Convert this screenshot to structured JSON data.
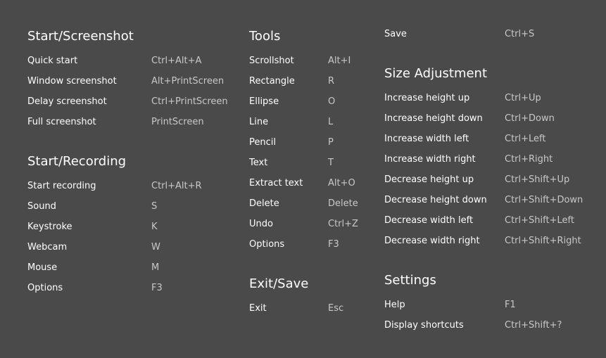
{
  "sections": {
    "start_screenshot": {
      "title": "Start/Screenshot",
      "items": [
        {
          "label": "Quick start",
          "key": "Ctrl+Alt+A"
        },
        {
          "label": "Window screenshot",
          "key": "Alt+PrintScreen"
        },
        {
          "label": "Delay screenshot",
          "key": "Ctrl+PrintScreen"
        },
        {
          "label": "Full screenshot",
          "key": "PrintScreen"
        }
      ]
    },
    "start_recording": {
      "title": "Start/Recording",
      "items": [
        {
          "label": "Start recording",
          "key": "Ctrl+Alt+R"
        },
        {
          "label": "Sound",
          "key": "S"
        },
        {
          "label": "Keystroke",
          "key": "K"
        },
        {
          "label": "Webcam",
          "key": "W"
        },
        {
          "label": "Mouse",
          "key": "M"
        },
        {
          "label": "Options",
          "key": "F3"
        }
      ]
    },
    "tools": {
      "title": "Tools",
      "items": [
        {
          "label": "Scrollshot",
          "key": "Alt+I"
        },
        {
          "label": "Rectangle",
          "key": "R"
        },
        {
          "label": "Ellipse",
          "key": "O"
        },
        {
          "label": "Line",
          "key": "L"
        },
        {
          "label": "Pencil",
          "key": "P"
        },
        {
          "label": "Text",
          "key": "T"
        },
        {
          "label": "Extract text",
          "key": "Alt+O"
        },
        {
          "label": "Delete",
          "key": "Delete"
        },
        {
          "label": "Undo",
          "key": "Ctrl+Z"
        },
        {
          "label": "Options",
          "key": "F3"
        }
      ]
    },
    "exit_save": {
      "title": "Exit/Save",
      "items": [
        {
          "label": "Exit",
          "key": "Esc"
        },
        {
          "label": "Save",
          "key": "Ctrl+S"
        }
      ]
    },
    "size_adjustment": {
      "title": "Size Adjustment",
      "items": [
        {
          "label": "Increase height up",
          "key": "Ctrl+Up"
        },
        {
          "label": "Increase height down",
          "key": "Ctrl+Down"
        },
        {
          "label": "Increase width left",
          "key": "Ctrl+Left"
        },
        {
          "label": "Increase width right",
          "key": "Ctrl+Right"
        },
        {
          "label": "Decrease height up",
          "key": "Ctrl+Shift+Up"
        },
        {
          "label": "Decrease height down",
          "key": "Ctrl+Shift+Down"
        },
        {
          "label": "Decrease width left",
          "key": "Ctrl+Shift+Left"
        },
        {
          "label": "Decrease width right",
          "key": "Ctrl+Shift+Right"
        }
      ]
    },
    "settings": {
      "title": "Settings",
      "items": [
        {
          "label": "Help",
          "key": "F1"
        },
        {
          "label": "Display shortcuts",
          "key": "Ctrl+Shift+?"
        }
      ]
    }
  },
  "colors": {
    "background": "#4a4a4a",
    "label": "#ffffff",
    "key": "#c8c8c8"
  }
}
